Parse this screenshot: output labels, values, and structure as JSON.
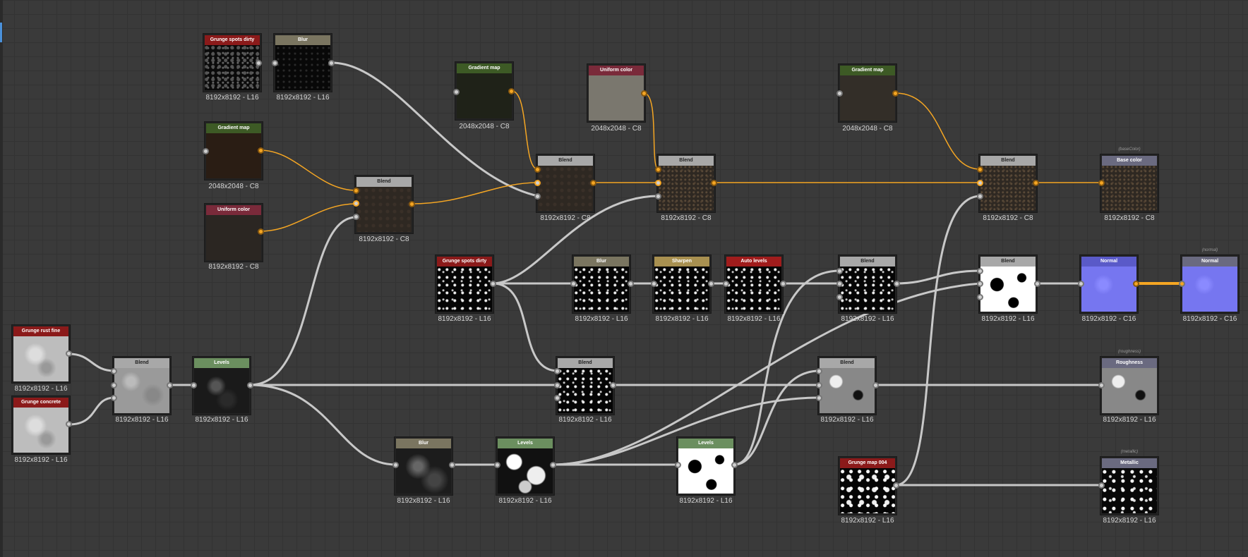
{
  "graph": {
    "nodes": [
      {
        "id": "n1",
        "title": "Grunge spots dirty",
        "res": "8192x8192 - L16"
      },
      {
        "id": "n2",
        "title": "Blur",
        "res": "8192x8192 - L16"
      },
      {
        "id": "n3",
        "title": "Gradient map",
        "res": "2048x2048 - C8"
      },
      {
        "id": "n4",
        "title": "Uniform color",
        "res": "8192x8192 - C8"
      },
      {
        "id": "n5",
        "title": "Blend",
        "res": "8192x8192 - C8"
      },
      {
        "id": "n6",
        "title": "Gradient map",
        "res": "2048x2048 - C8"
      },
      {
        "id": "n7",
        "title": "Uniform color",
        "res": "2048x2048 - C8"
      },
      {
        "id": "n8",
        "title": "Blend",
        "res": "8192x8192 - C8"
      },
      {
        "id": "n9",
        "title": "Blend",
        "res": "8192x8192 - C8"
      },
      {
        "id": "n10",
        "title": "Gradient map",
        "res": "2048x2048 - C8"
      },
      {
        "id": "n11",
        "title": "Blend",
        "res": "8192x8192 - C8"
      },
      {
        "id": "n12",
        "title": "Base color",
        "res": "8192x8192 - C8",
        "tag": "(baseColor)"
      },
      {
        "id": "n13",
        "title": "Grunge spots dirty",
        "res": "8192x8192 - L16"
      },
      {
        "id": "n14",
        "title": "Blur",
        "res": "8192x8192 - L16"
      },
      {
        "id": "n15",
        "title": "Sharpen",
        "res": "8192x8192 - L16"
      },
      {
        "id": "n16",
        "title": "Auto levels",
        "res": "8192x8192 - L16"
      },
      {
        "id": "n17",
        "title": "Blend",
        "res": "8192x8192 - L16"
      },
      {
        "id": "n18",
        "title": "Blend",
        "res": "8192x8192 - L16"
      },
      {
        "id": "n19",
        "title": "Normal",
        "res": "8192x8192 - C16"
      },
      {
        "id": "n20",
        "title": "Normal",
        "res": "8192x8192 - C16",
        "tag": "(normal)"
      },
      {
        "id": "n21",
        "title": "Grunge rust fine",
        "res": "8192x8192 - L16"
      },
      {
        "id": "n22",
        "title": "Grunge concrete",
        "res": "8192x8192 - L16"
      },
      {
        "id": "n23",
        "title": "Blend",
        "res": "8192x8192 - L16"
      },
      {
        "id": "n24",
        "title": "Levels",
        "res": "8192x8192 - L16"
      },
      {
        "id": "n25",
        "title": "Blend",
        "res": "8192x8192 - L16"
      },
      {
        "id": "n26",
        "title": "Blend",
        "res": "8192x8192 - L16"
      },
      {
        "id": "n27",
        "title": "Roughness",
        "res": "8192x8192 - L16",
        "tag": "(roughness)"
      },
      {
        "id": "n28",
        "title": "Blur",
        "res": "8192x8192 - L16"
      },
      {
        "id": "n29",
        "title": "Levels",
        "res": "8192x8192 - L16"
      },
      {
        "id": "n30",
        "title": "Levels",
        "res": "8192x8192 - L16"
      },
      {
        "id": "n31",
        "title": "Grunge map 004",
        "res": "8192x8192 - L16"
      },
      {
        "id": "n32",
        "title": "Metallic",
        "res": "8192x8192 - L16",
        "tag": "(metallic)"
      }
    ]
  },
  "colors": {
    "canvas": "#3a3a3a",
    "wire_gray": "#c8c8c8",
    "wire_orange": "#f5a623"
  }
}
